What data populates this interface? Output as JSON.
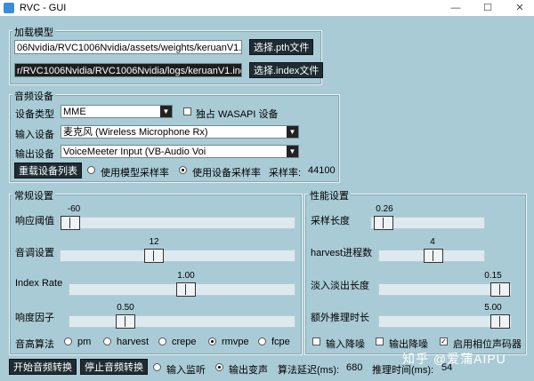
{
  "window": {
    "title": "RVC - GUI",
    "min": "—",
    "max": "☐",
    "close": "✕"
  },
  "load_model": {
    "label": "加载模型",
    "pth_path": "06Nvidia/RVC1006Nvidia/assets/weights/keruanV1.pth",
    "pth_button": "选择.pth文件",
    "index_path": "r/RVC1006Nvidia/RVC1006Nvidia/logs/keruanV1.index",
    "index_button": "选择.index文件"
  },
  "audio_device": {
    "label": "音频设备",
    "type_label": "设备类型",
    "type_value": "MME",
    "exclusive_label": "独占 WASAPI 设备",
    "input_label": "输入设备",
    "input_value": "麦克风 (Wireless Microphone Rx)",
    "output_label": "输出设备",
    "output_value": "VoiceMeeter Input (VB-Audio Voi",
    "reload_button": "重载设备列表",
    "rate_model_label": "使用模型采样率",
    "rate_device_label": "使用设备采样率",
    "sample_rate_label": "采样率:",
    "sample_rate_value": "44100"
  },
  "general": {
    "label": "常规设置",
    "threshold": {
      "label": "响应阈值",
      "value": "-60",
      "fraction": 0.0
    },
    "pitch": {
      "label": "音调设置",
      "value": "12",
      "fraction": 0.74
    },
    "index_rate": {
      "label": "Index Rate",
      "value": "1.00",
      "fraction": 1.0
    },
    "rms": {
      "label": "响度因子",
      "value": "0.50",
      "fraction": 0.5
    },
    "f0_label": "音高算法",
    "f0_options": [
      "pm",
      "harvest",
      "crepe",
      "rmvpe",
      "fcpe"
    ],
    "f0_selected": "rmvpe"
  },
  "performance": {
    "label": "性能设置",
    "block": {
      "label": "采样长度",
      "value": "0.26",
      "fraction": 0.03
    },
    "harvest": {
      "label": "harvest进程数",
      "value": "4",
      "fraction": 0.43
    },
    "crossfade": {
      "label": "淡入淡出长度",
      "value": "0.15",
      "fraction": 1.0
    },
    "extra": {
      "label": "额外推理时长",
      "value": "5.00",
      "fraction": 1.0
    },
    "noise_in": "输入降噪",
    "noise_out": "输出降噪",
    "phase_vocoder": "启用相位声码器"
  },
  "bottom": {
    "start_button": "开始音频转换",
    "stop_button": "停止音频转换",
    "monitor_label": "输入监听",
    "output_label": "输出变声",
    "delay_label": "算法延迟(ms):",
    "delay_value": "680",
    "infer_label": "推理时间(ms):",
    "infer_value": "54"
  },
  "watermark": "知乎 @爱蒲AIPU"
}
